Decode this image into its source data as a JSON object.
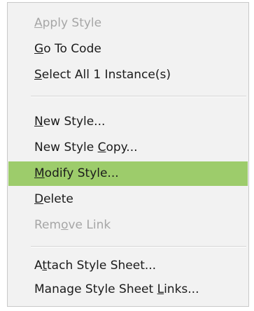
{
  "menu": {
    "items": [
      {
        "pre": "",
        "key": "A",
        "post": "pply Style",
        "disabled": true
      },
      {
        "pre": "",
        "key": "G",
        "post": "o To Code",
        "disabled": false
      },
      {
        "pre": "",
        "key": "S",
        "post": "elect All 1 Instance(s)",
        "disabled": false
      },
      {
        "pre": "",
        "key": "N",
        "post": "ew Style...",
        "disabled": false
      },
      {
        "pre": "New Style ",
        "key": "C",
        "post": "opy...",
        "disabled": false
      },
      {
        "pre": "",
        "key": "M",
        "post": "odify Style...",
        "disabled": false,
        "highlighted": true
      },
      {
        "pre": "",
        "key": "D",
        "post": "elete",
        "disabled": false
      },
      {
        "pre": "Rem",
        "key": "o",
        "post": "ve Link",
        "disabled": true
      },
      {
        "pre": "A",
        "key": "t",
        "post": "tach Style Sheet...",
        "disabled": false
      },
      {
        "pre": "Manage Style Sheet ",
        "key": "L",
        "post": "inks...",
        "disabled": false
      }
    ]
  },
  "colors": {
    "highlight": "#9dcc6b",
    "menu_background": "#f2f2f2",
    "disabled_text": "#a6a6a6"
  }
}
